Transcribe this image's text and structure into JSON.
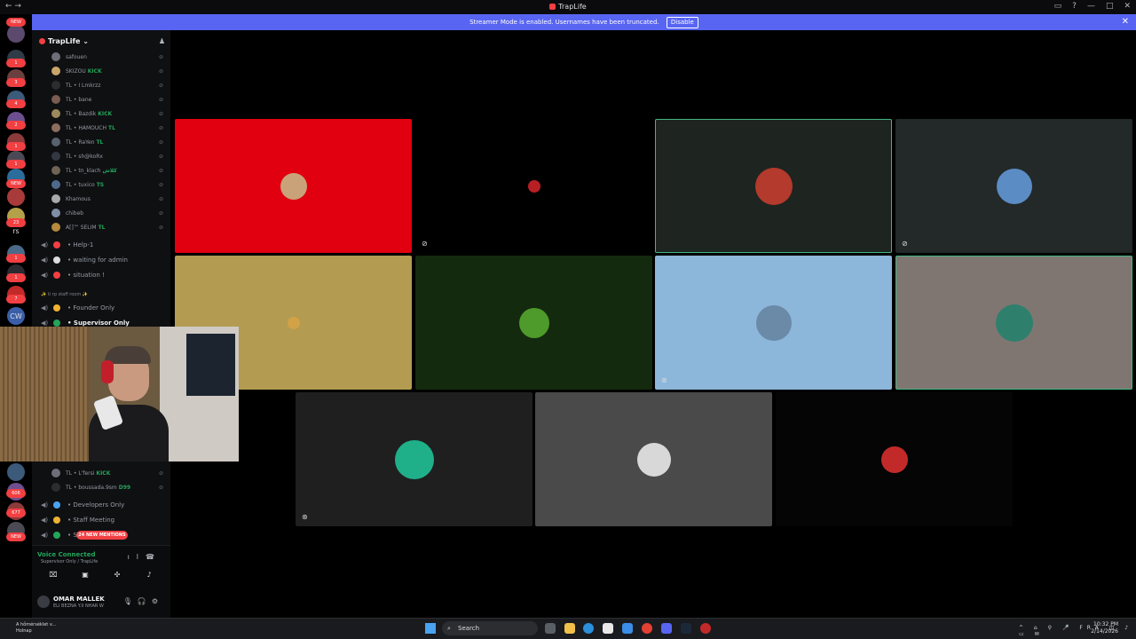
{
  "window": {
    "title": "TrapLife",
    "controls": [
      "inbox-icon",
      "help-icon",
      "minimize-icon",
      "maximize-icon",
      "close-icon"
    ]
  },
  "banner": {
    "text": "Streamer Mode is enabled. Usernames have been truncated.",
    "button": "Disable"
  },
  "server_rail": {
    "badges": [
      "NEW",
      "1",
      "3",
      "4",
      "2",
      "1",
      "1",
      "NEW",
      "CW",
      "23",
      "1",
      "1",
      "7",
      "606",
      "677",
      "NEW"
    ],
    "text_items": [
      "rs",
      "CW"
    ]
  },
  "guild": {
    "name": "TrapLife"
  },
  "voice_users_top": [
    {
      "prefix": "",
      "name": "safouen",
      "tag": "",
      "color": "#6d6f78"
    },
    {
      "prefix": "",
      "name": "SKIZOU",
      "tag": "KICK",
      "color": "#caa56a"
    },
    {
      "prefix": "TL",
      "name": "I Lmkrzz",
      "tag": "",
      "color": "#2b2d31"
    },
    {
      "prefix": "TL",
      "name": "bane",
      "tag": "",
      "color": "#7a5c52"
    },
    {
      "prefix": "TL",
      "name": "Bazdik",
      "tag": "KICK",
      "color": "#9b8a5c"
    },
    {
      "prefix": "TL",
      "name": "HAMOUCH",
      "tag": "TL",
      "color": "#8c6d5f"
    },
    {
      "prefix": "TL",
      "name": "RaYen",
      "tag": "TL",
      "color": "#58616e"
    },
    {
      "prefix": "TL",
      "name": "sh@koRx",
      "tag": "",
      "color": "#333840"
    },
    {
      "prefix": "TL",
      "name": "tn_klach",
      "tag": "كلاش",
      "color": "#6e6355"
    },
    {
      "prefix": "TL",
      "name": "tuxico",
      "tag": "TS",
      "color": "#4d6a8c"
    },
    {
      "prefix": "",
      "name": "Khamous",
      "tag": "",
      "color": "#a9a9a9"
    },
    {
      "prefix": "",
      "name": "chibeb",
      "tag": "",
      "color": "#7f8fa6"
    },
    {
      "prefix": "",
      "name": "A[]™ SELIM",
      "tag": "TL",
      "color": "#b58a3c"
    }
  ],
  "channels_top": [
    {
      "name": "Help-1",
      "emoji_color": "#f23f42"
    },
    {
      "name": "waiting for admin",
      "emoji_color": "#dbdee1"
    },
    {
      "name": "situation !",
      "emoji_color": "#f23f42"
    }
  ],
  "category": "ti rp staff room",
  "channels_mid": [
    {
      "name": "Founder Only",
      "emoji_color": "#f0b232",
      "active": false
    },
    {
      "name": "Supervisor Only",
      "emoji_color": "#23a55a",
      "active": true
    }
  ],
  "voice_users_bottom": [
    {
      "prefix": "TL",
      "name": "L'fersi",
      "tag": "KICK",
      "color": "#6d6f78"
    },
    {
      "prefix": "TL",
      "name": "boussada.9sm",
      "tag": "D99",
      "color": "#2b2d31"
    }
  ],
  "channels_bottom": [
    {
      "name": "Developers Only",
      "emoji_color": "#4aa3f0"
    },
    {
      "name": "Staff Meeting",
      "emoji_color": "#f0b232"
    },
    {
      "name": "St",
      "emoji_color": "#23a55a"
    }
  ],
  "mentions_pill": "24 NEW MENTIONS",
  "voice_panel": {
    "status": "Voice Connected",
    "channel": "Supervisor Only / TrapLife"
  },
  "user": {
    "name": "OMAR MALLEK",
    "status": "ELI BEZNA Y.II NHAR W"
  },
  "tiles": [
    {
      "bg": "#e0000f",
      "border": "none",
      "avatar_color": "#c9a27a",
      "size": 30,
      "indicator": ""
    },
    {
      "bg": "#000000",
      "border": "none",
      "avatar_color": "#b81f24",
      "size": 14,
      "indicator": "mute-icon"
    },
    {
      "bg": "#1e2420",
      "border": "#43b581",
      "avatar_color": "#b33a2c",
      "size": 42,
      "indicator": ""
    },
    {
      "bg": "#232829",
      "border": "none",
      "avatar_color": "#5b8cc4",
      "size": 40,
      "indicator": "mute-icon"
    },
    {
      "bg": "#b39b52",
      "border": "none",
      "avatar_color": "#d1a246",
      "size": 14,
      "indicator": ""
    },
    {
      "bg": "#142a0e",
      "border": "none",
      "avatar_color": "#4e9a2a",
      "size": 34,
      "indicator": ""
    },
    {
      "bg": "#8cb6da",
      "border": "none",
      "avatar_color": "#6b8aa8",
      "size": 40,
      "indicator": "deafen-icon"
    },
    {
      "bg": "#7f7672",
      "border": "#43b581",
      "avatar_color": "#2f7f6d",
      "size": 42,
      "indicator": ""
    },
    {
      "bg": "#1f1f20",
      "border": "none",
      "avatar_color": "#1fb08a",
      "size": 44,
      "indicator": "deafen-icon"
    },
    {
      "bg": "#4a4a4a",
      "border": "none",
      "avatar_color": "#d8d8d8",
      "size": 38,
      "indicator": ""
    },
    {
      "bg": "#050505",
      "border": "none",
      "avatar_color": "#c22a2a",
      "size": 30,
      "indicator": ""
    }
  ],
  "taskbar": {
    "weather_line1": "A hőmérséklet v...",
    "weather_line2": "Holnap",
    "search": "Search",
    "language": "FRA",
    "time": "10:32 PM",
    "date": "2/14/2026"
  }
}
